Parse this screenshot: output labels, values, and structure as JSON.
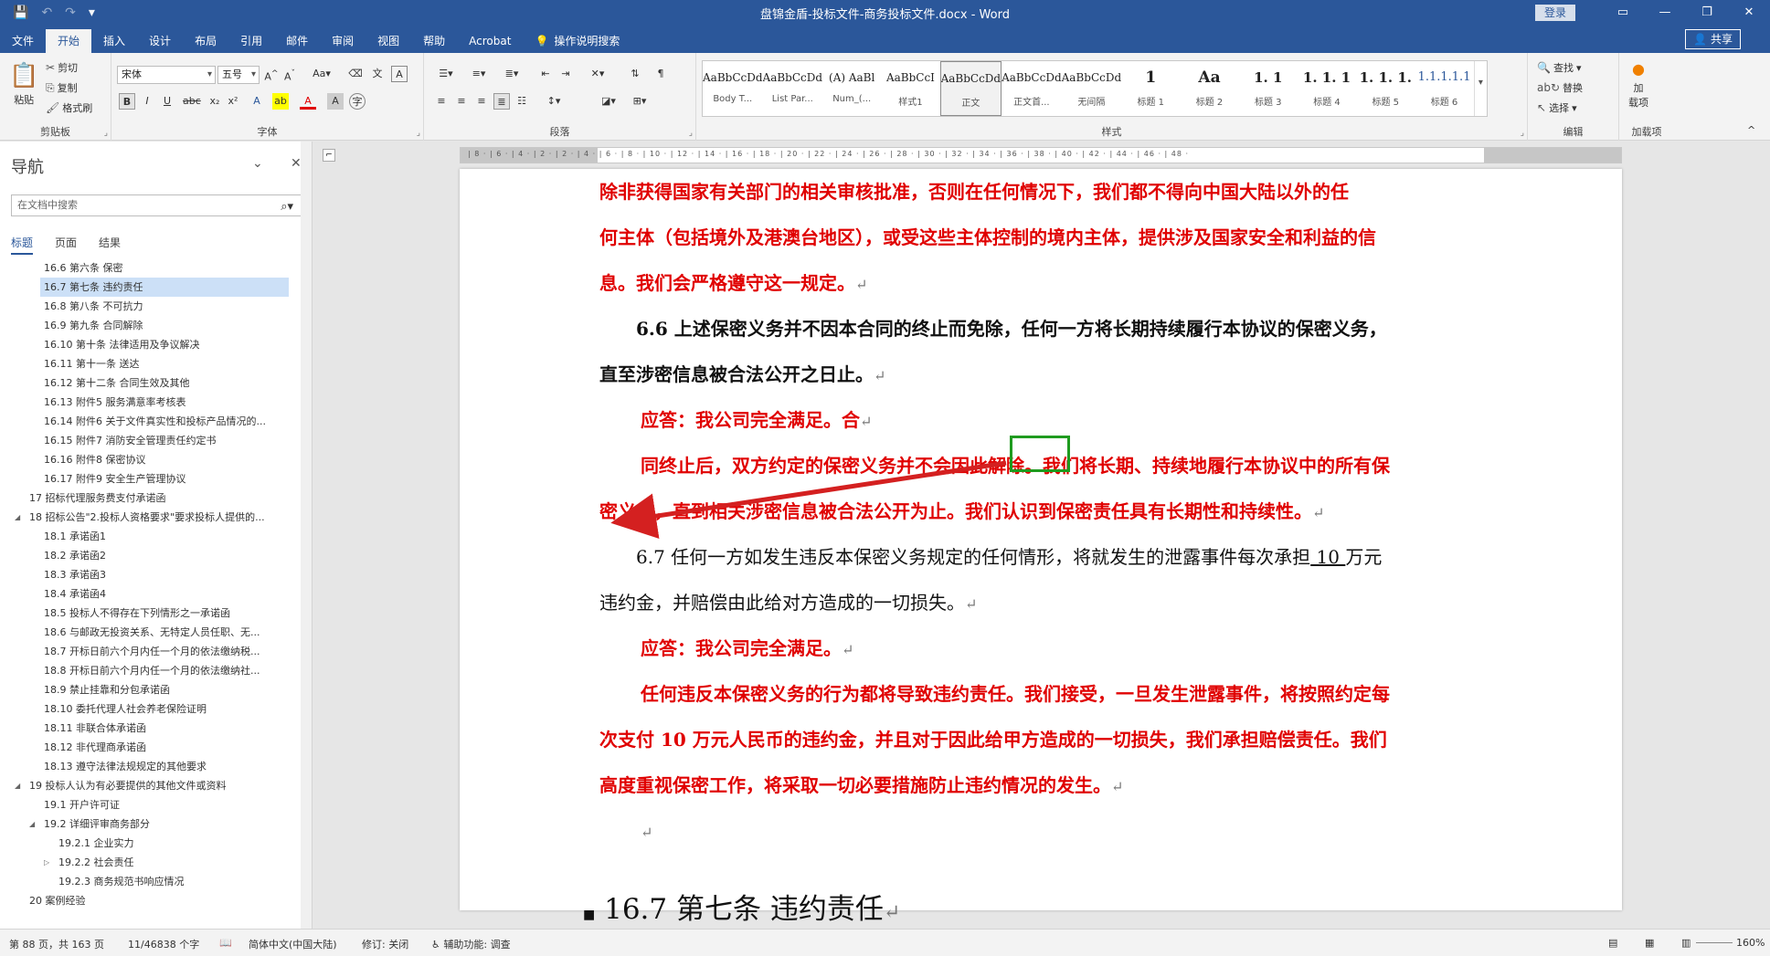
{
  "window": {
    "title": "盘锦金盾-投标文件-商务投标文件.docx - Word",
    "login": "登录"
  },
  "tabs": [
    "文件",
    "开始",
    "插入",
    "设计",
    "布局",
    "引用",
    "邮件",
    "审阅",
    "视图",
    "帮助",
    "Acrobat"
  ],
  "tell_me": "操作说明搜索",
  "share": "共享",
  "ribbon": {
    "clipboard": {
      "label": "剪贴板",
      "paste": "粘贴",
      "cut": "剪切",
      "copy": "复制",
      "painter": "格式刷"
    },
    "font": {
      "label": "字体",
      "name": "宋体",
      "size": "五号"
    },
    "paragraph": {
      "label": "段落"
    },
    "styles": {
      "label": "样式",
      "items": [
        {
          "sample": "AaBbCcDd",
          "name": "Body T..."
        },
        {
          "sample": "AaBbCcDd",
          "name": "List Par..."
        },
        {
          "sample": "(A) AaBl",
          "name": "Num_(..."
        },
        {
          "sample": "AaBbCcI",
          "name": "样式1"
        },
        {
          "sample": "AaBbCcDd",
          "name": "正文"
        },
        {
          "sample": "AaBbCcDd",
          "name": "正文首..."
        },
        {
          "sample": "AaBbCcDd",
          "name": "无间隔"
        },
        {
          "sample": "1",
          "name": "标题 1"
        },
        {
          "sample": "Aa",
          "name": "标题 2"
        },
        {
          "sample": "1. 1",
          "name": "标题 3"
        },
        {
          "sample": "1. 1. 1",
          "name": "标题 4"
        },
        {
          "sample": "1. 1. 1.",
          "name": "标题 5"
        },
        {
          "sample": "1.1.1.1.1",
          "name": "标题 6"
        }
      ]
    },
    "editing": {
      "label": "编辑",
      "find": "查找",
      "replace": "替换",
      "select": "选择"
    },
    "addins": {
      "label": "加载项",
      "btn": "加\n载项"
    }
  },
  "nav": {
    "title": "导航",
    "search_placeholder": "在文档中搜索",
    "tabs": [
      "标题",
      "页面",
      "结果"
    ],
    "items": [
      {
        "text": "16.6 第六条 保密",
        "level": 2
      },
      {
        "text": "16.7 第七条 违约责任",
        "level": 2,
        "selected": true
      },
      {
        "text": "16.8 第八条 不可抗力",
        "level": 2
      },
      {
        "text": "16.9 第九条 合同解除",
        "level": 2
      },
      {
        "text": "16.10 第十条 法律适用及争议解决",
        "level": 2
      },
      {
        "text": "16.11 第十一条 送达",
        "level": 2
      },
      {
        "text": "16.12 第十二条 合同生效及其他",
        "level": 2
      },
      {
        "text": "16.13 附件5 服务满意率考核表",
        "level": 2
      },
      {
        "text": "16.14 附件6 关于文件真实性和投标产品情况的...",
        "level": 2
      },
      {
        "text": "16.15 附件7 消防安全管理责任约定书",
        "level": 2
      },
      {
        "text": "16.16 附件8 保密协议",
        "level": 2
      },
      {
        "text": "16.17 附件9 安全生产管理协议",
        "level": 2
      },
      {
        "text": "17 招标代理服务费支付承诺函",
        "level": 1
      },
      {
        "text": "18 招标公告\"2.投标人资格要求\"要求投标人提供的...",
        "level": 1,
        "expanded": true
      },
      {
        "text": "18.1 承诺函1",
        "level": 2
      },
      {
        "text": "18.2 承诺函2",
        "level": 2
      },
      {
        "text": "18.3 承诺函3",
        "level": 2
      },
      {
        "text": "18.4 承诺函4",
        "level": 2
      },
      {
        "text": "18.5 投标人不得存在下列情形之一承诺函",
        "level": 2
      },
      {
        "text": "18.6 与邮政无投资关系、无特定人员任职、无...",
        "level": 2
      },
      {
        "text": "18.7 开标日前六个月内任一个月的依法缴纳税...",
        "level": 2
      },
      {
        "text": "18.8 开标日前六个月内任一个月的依法缴纳社...",
        "level": 2
      },
      {
        "text": "18.9 禁止挂靠和分包承诺函",
        "level": 2
      },
      {
        "text": "18.10 委托代理人社会养老保险证明",
        "level": 2
      },
      {
        "text": "18.11 非联合体承诺函",
        "level": 2
      },
      {
        "text": "18.12 非代理商承诺函",
        "level": 2
      },
      {
        "text": "18.13 遵守法律法规规定的其他要求",
        "level": 2
      },
      {
        "text": "19 投标人认为有必要提供的其他文件或资料",
        "level": 1,
        "expanded": true
      },
      {
        "text": "19.1 开户许可证",
        "level": 2
      },
      {
        "text": "19.2 详细评审商务部分",
        "level": 2,
        "expanded": true
      },
      {
        "text": "19.2.1 企业实力",
        "level": 3
      },
      {
        "text": "19.2.2 社会责任",
        "level": 3,
        "collapsed": true
      },
      {
        "text": "19.2.3 商务规范书响应情况",
        "level": 3
      },
      {
        "text": "20 案例经验",
        "level": 1
      }
    ]
  },
  "document": {
    "p1_l1": "除非获得国家有关部门的相关审核批准，否则在任何情况下，我们都不得向中国大陆以外的任",
    "p1_l2": "何主体（包括境外及港澳台地区），或受这些主体控制的境内主体，提供涉及国家安全和利益的信",
    "p1_l3": "息。我们会严格遵守这一规定。",
    "p2_l1": "6.6  上述保密义务并不因本合同的终止而免除，任何一方将长期持续履行本协议的保密义务，",
    "p2_l2": "直至涉密信息被合法公开之日止。",
    "p3": "应答：我公司完全满足。",
    "p3_cursor": "合",
    "p4_l1": "同终止后，双方约定的保密义务并不会因此解除。我们将长期、持续地履行本协议中的所有保",
    "p4_l2": "密义务，直到相关涉密信息被合法公开为止。我们认识到保密责任具有长期性和持续性。",
    "p5_l1a": "6.7  任何一方如发生违反本保密义务规定的任何情形，将就发生的泄露事件每次承担",
    "p5_amount": "  10  ",
    "p5_l1b": "万元",
    "p5_l2": "违约金，并赔偿由此给对方造成的一切损失。",
    "p6": "应答：我公司完全满足。",
    "p7_l1": "任何违反本保密义务的行为都将导致违约责任。我们接受，一旦发生泄露事件，将按照约定每",
    "p7_l2": "次支付 10 万元人民币的违约金，并且对于因此给甲方造成的一切损失，我们承担赔偿责任。我们",
    "p7_l3": "高度重视保密工作，将采取一切必要措施防止违约情况的发生。",
    "heading": "16.7  第七条  违约责任",
    "para_mark": "↵"
  },
  "status": {
    "page": "第 88 页，共 163 页",
    "words": "11/46838 个字",
    "lang": "简体中文(中国大陆)",
    "track": "修订: 关闭",
    "access": "辅助功能: 调查",
    "zoom": "160%"
  },
  "colors": {
    "brand": "#2b579a",
    "red_text": "#e00000",
    "annot_box": "#1f9b1f",
    "arrow": "#d42020"
  }
}
